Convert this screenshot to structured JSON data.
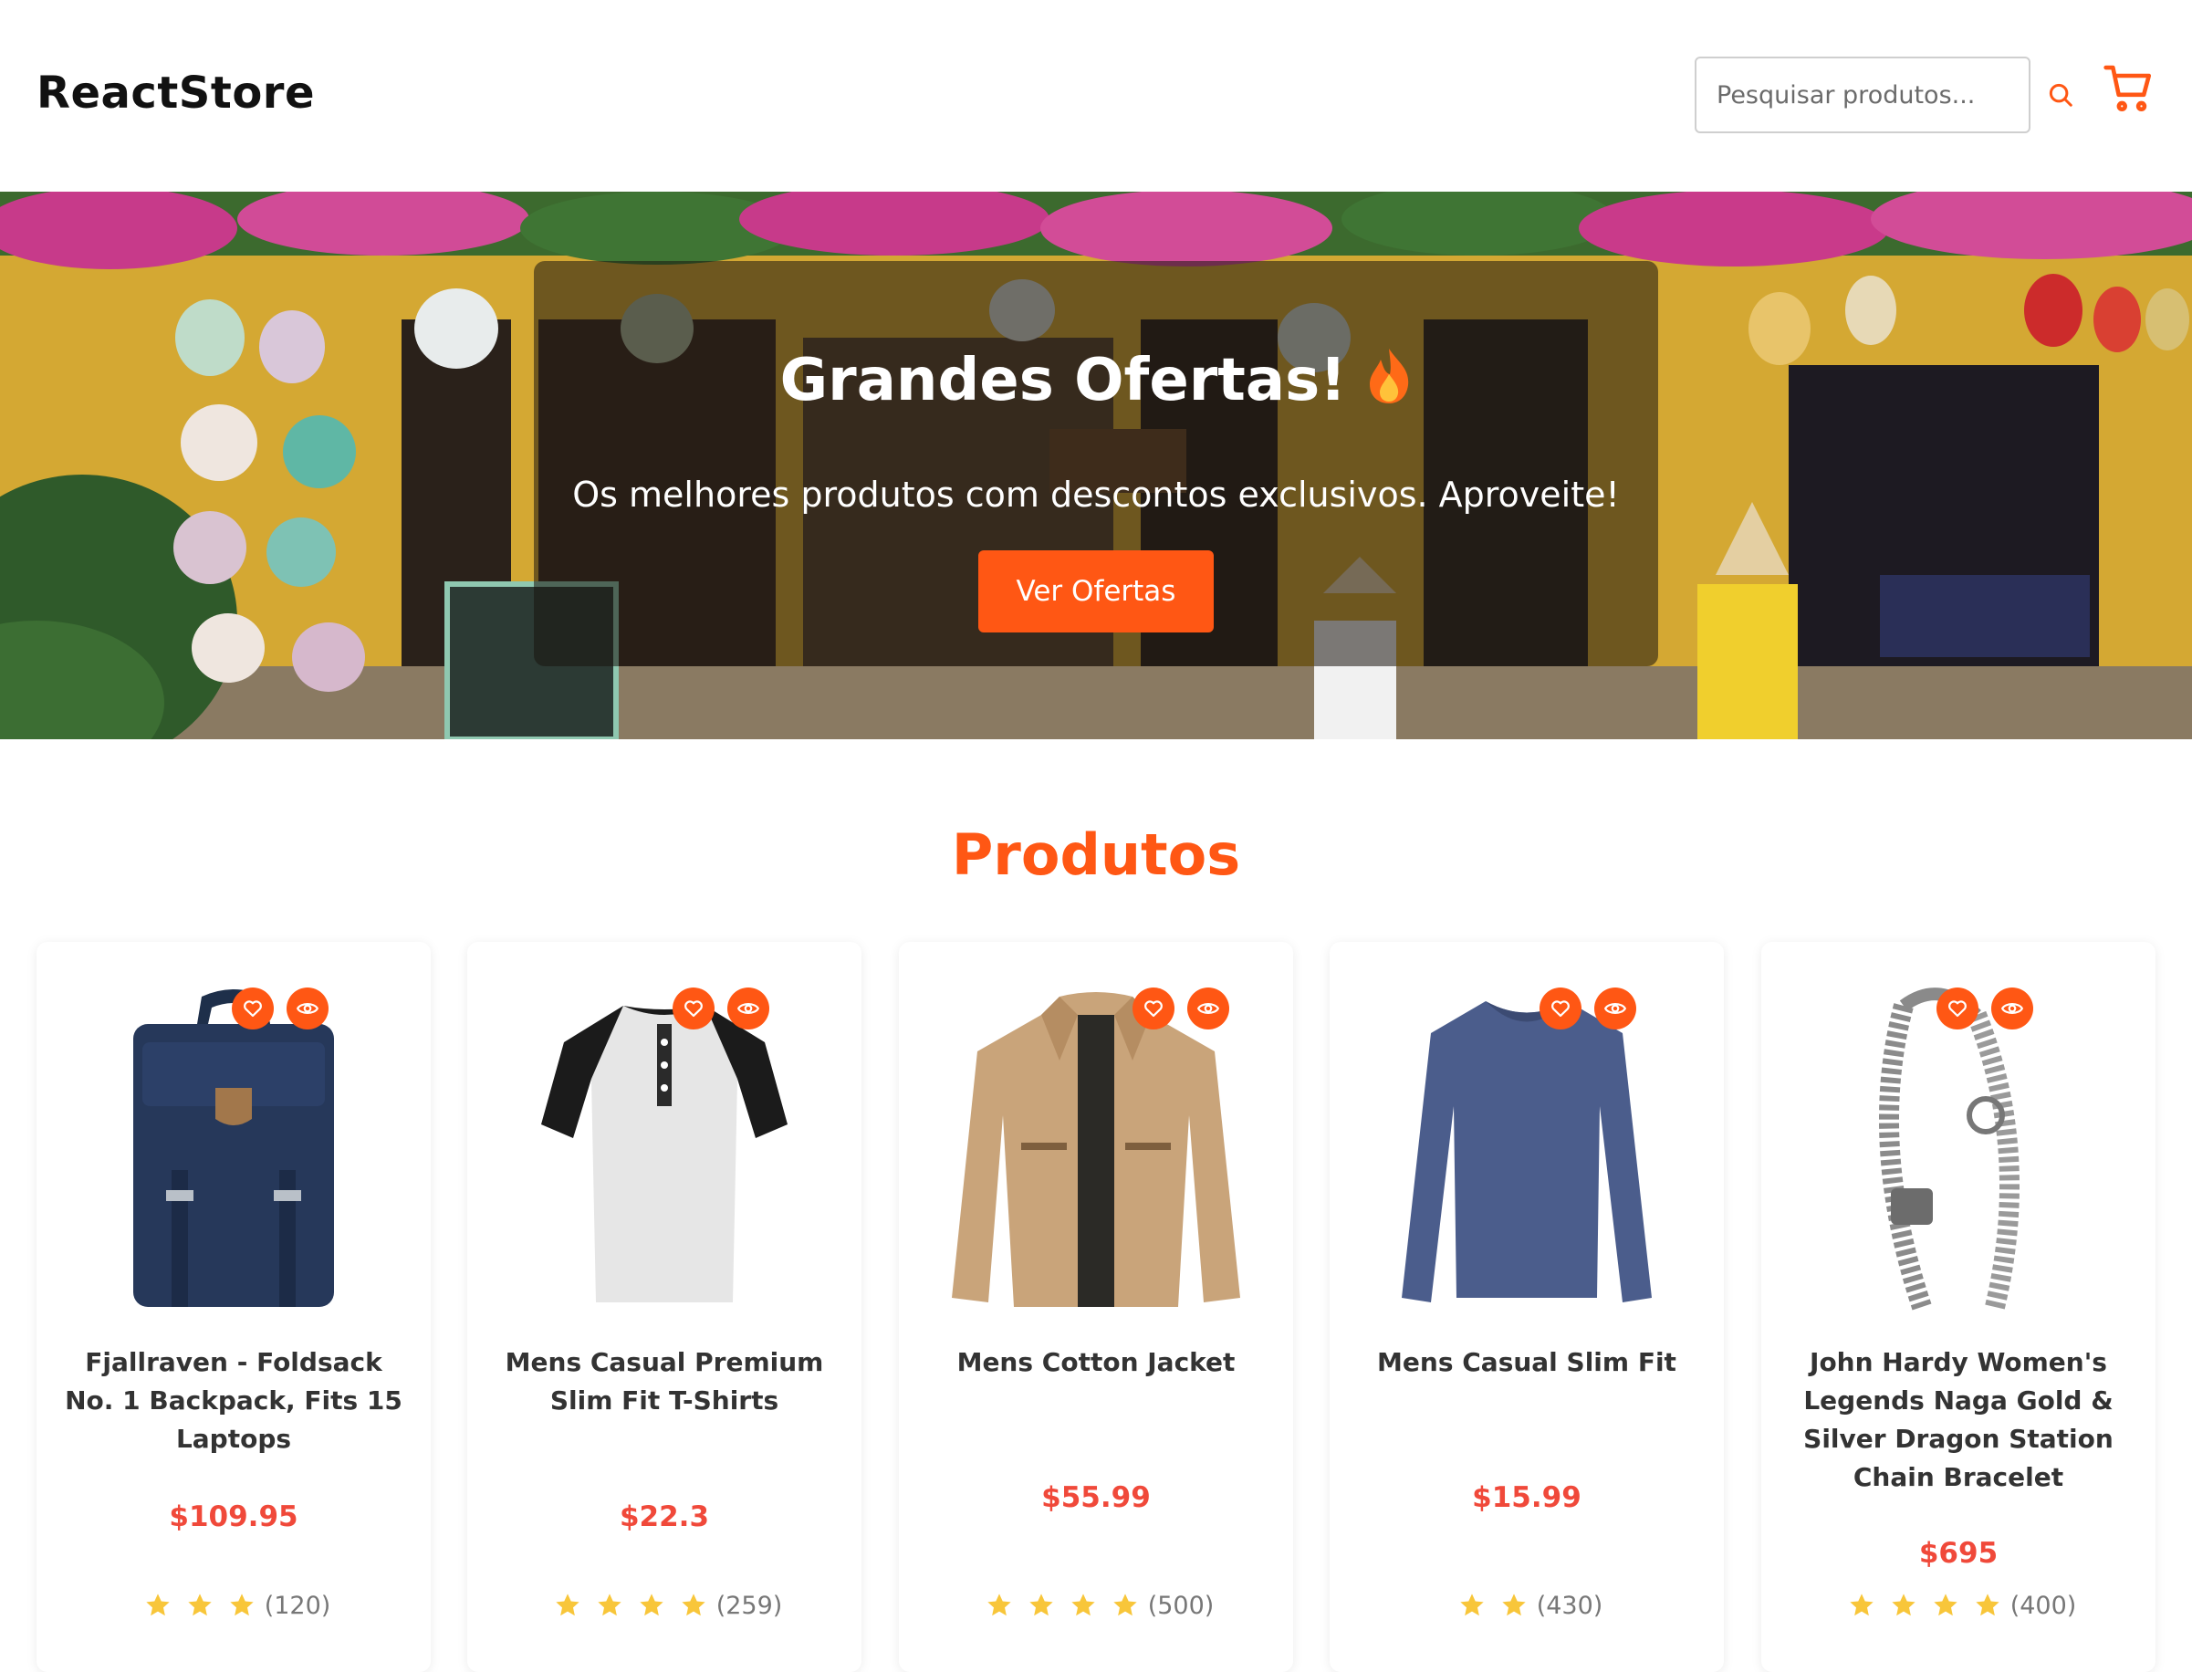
{
  "brand": {
    "name": "ReactStore"
  },
  "search": {
    "placeholder": "Pesquisar produtos..."
  },
  "icons": {
    "search": "search-icon",
    "cart": "cart-icon",
    "favorite": "heart-icon",
    "view": "eye-icon",
    "rating": "star-icon",
    "flame": "fire-icon"
  },
  "colors": {
    "accent": "#ff5714",
    "price": "#f0493a",
    "star": "#f8c63a"
  },
  "hero": {
    "title": "Grandes Ofertas!",
    "subtitle": "Os melhores produtos com descontos exclusivos. Aproveite!",
    "cta": "Ver Ofertas"
  },
  "products_section": {
    "title": "Produtos"
  },
  "products": [
    {
      "name": "Fjallraven - Foldsack No. 1 Backpack, Fits 15 Laptops",
      "price": "$109.95",
      "stars": 3,
      "count": "(120)"
    },
    {
      "name": "Mens Casual Premium Slim Fit T-Shirts",
      "price": "$22.3",
      "stars": 4,
      "count": "(259)"
    },
    {
      "name": "Mens Cotton Jacket",
      "price": "$55.99",
      "stars": 4,
      "count": "(500)"
    },
    {
      "name": "Mens Casual Slim Fit",
      "price": "$15.99",
      "stars": 2,
      "count": "(430)"
    },
    {
      "name": "John Hardy Women's Legends Naga Gold & Silver Dragon Station Chain Bracelet",
      "price": "$695",
      "stars": 4,
      "count": "(400)"
    }
  ]
}
